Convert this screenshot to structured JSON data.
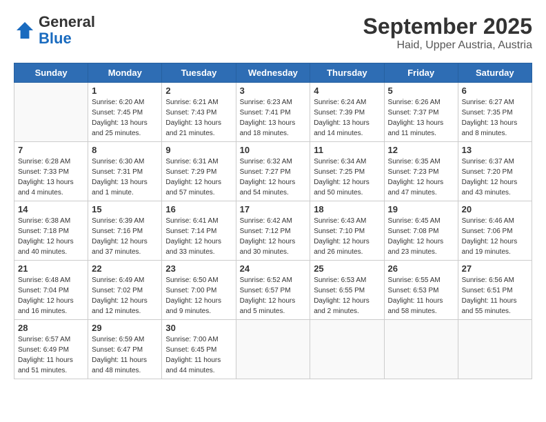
{
  "header": {
    "logo_general": "General",
    "logo_blue": "Blue",
    "month_title": "September 2025",
    "location": "Haid, Upper Austria, Austria"
  },
  "calendar": {
    "days_of_week": [
      "Sunday",
      "Monday",
      "Tuesday",
      "Wednesday",
      "Thursday",
      "Friday",
      "Saturday"
    ],
    "weeks": [
      [
        {
          "day": "",
          "info": ""
        },
        {
          "day": "1",
          "info": "Sunrise: 6:20 AM\nSunset: 7:45 PM\nDaylight: 13 hours\nand 25 minutes."
        },
        {
          "day": "2",
          "info": "Sunrise: 6:21 AM\nSunset: 7:43 PM\nDaylight: 13 hours\nand 21 minutes."
        },
        {
          "day": "3",
          "info": "Sunrise: 6:23 AM\nSunset: 7:41 PM\nDaylight: 13 hours\nand 18 minutes."
        },
        {
          "day": "4",
          "info": "Sunrise: 6:24 AM\nSunset: 7:39 PM\nDaylight: 13 hours\nand 14 minutes."
        },
        {
          "day": "5",
          "info": "Sunrise: 6:26 AM\nSunset: 7:37 PM\nDaylight: 13 hours\nand 11 minutes."
        },
        {
          "day": "6",
          "info": "Sunrise: 6:27 AM\nSunset: 7:35 PM\nDaylight: 13 hours\nand 8 minutes."
        }
      ],
      [
        {
          "day": "7",
          "info": "Sunrise: 6:28 AM\nSunset: 7:33 PM\nDaylight: 13 hours\nand 4 minutes."
        },
        {
          "day": "8",
          "info": "Sunrise: 6:30 AM\nSunset: 7:31 PM\nDaylight: 13 hours\nand 1 minute."
        },
        {
          "day": "9",
          "info": "Sunrise: 6:31 AM\nSunset: 7:29 PM\nDaylight: 12 hours\nand 57 minutes."
        },
        {
          "day": "10",
          "info": "Sunrise: 6:32 AM\nSunset: 7:27 PM\nDaylight: 12 hours\nand 54 minutes."
        },
        {
          "day": "11",
          "info": "Sunrise: 6:34 AM\nSunset: 7:25 PM\nDaylight: 12 hours\nand 50 minutes."
        },
        {
          "day": "12",
          "info": "Sunrise: 6:35 AM\nSunset: 7:23 PM\nDaylight: 12 hours\nand 47 minutes."
        },
        {
          "day": "13",
          "info": "Sunrise: 6:37 AM\nSunset: 7:20 PM\nDaylight: 12 hours\nand 43 minutes."
        }
      ],
      [
        {
          "day": "14",
          "info": "Sunrise: 6:38 AM\nSunset: 7:18 PM\nDaylight: 12 hours\nand 40 minutes."
        },
        {
          "day": "15",
          "info": "Sunrise: 6:39 AM\nSunset: 7:16 PM\nDaylight: 12 hours\nand 37 minutes."
        },
        {
          "day": "16",
          "info": "Sunrise: 6:41 AM\nSunset: 7:14 PM\nDaylight: 12 hours\nand 33 minutes."
        },
        {
          "day": "17",
          "info": "Sunrise: 6:42 AM\nSunset: 7:12 PM\nDaylight: 12 hours\nand 30 minutes."
        },
        {
          "day": "18",
          "info": "Sunrise: 6:43 AM\nSunset: 7:10 PM\nDaylight: 12 hours\nand 26 minutes."
        },
        {
          "day": "19",
          "info": "Sunrise: 6:45 AM\nSunset: 7:08 PM\nDaylight: 12 hours\nand 23 minutes."
        },
        {
          "day": "20",
          "info": "Sunrise: 6:46 AM\nSunset: 7:06 PM\nDaylight: 12 hours\nand 19 minutes."
        }
      ],
      [
        {
          "day": "21",
          "info": "Sunrise: 6:48 AM\nSunset: 7:04 PM\nDaylight: 12 hours\nand 16 minutes."
        },
        {
          "day": "22",
          "info": "Sunrise: 6:49 AM\nSunset: 7:02 PM\nDaylight: 12 hours\nand 12 minutes."
        },
        {
          "day": "23",
          "info": "Sunrise: 6:50 AM\nSunset: 7:00 PM\nDaylight: 12 hours\nand 9 minutes."
        },
        {
          "day": "24",
          "info": "Sunrise: 6:52 AM\nSunset: 6:57 PM\nDaylight: 12 hours\nand 5 minutes."
        },
        {
          "day": "25",
          "info": "Sunrise: 6:53 AM\nSunset: 6:55 PM\nDaylight: 12 hours\nand 2 minutes."
        },
        {
          "day": "26",
          "info": "Sunrise: 6:55 AM\nSunset: 6:53 PM\nDaylight: 11 hours\nand 58 minutes."
        },
        {
          "day": "27",
          "info": "Sunrise: 6:56 AM\nSunset: 6:51 PM\nDaylight: 11 hours\nand 55 minutes."
        }
      ],
      [
        {
          "day": "28",
          "info": "Sunrise: 6:57 AM\nSunset: 6:49 PM\nDaylight: 11 hours\nand 51 minutes."
        },
        {
          "day": "29",
          "info": "Sunrise: 6:59 AM\nSunset: 6:47 PM\nDaylight: 11 hours\nand 48 minutes."
        },
        {
          "day": "30",
          "info": "Sunrise: 7:00 AM\nSunset: 6:45 PM\nDaylight: 11 hours\nand 44 minutes."
        },
        {
          "day": "",
          "info": ""
        },
        {
          "day": "",
          "info": ""
        },
        {
          "day": "",
          "info": ""
        },
        {
          "day": "",
          "info": ""
        }
      ]
    ]
  }
}
